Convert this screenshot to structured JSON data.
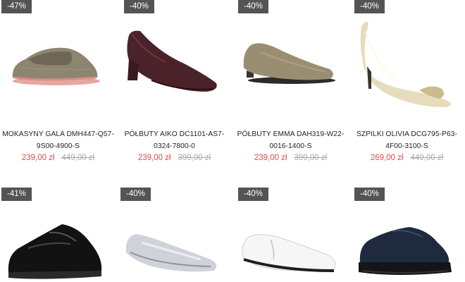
{
  "products": [
    {
      "discount": "-47%",
      "name_line1": "MOKASYNY GALA DMH447-Q57-",
      "name_line2": "9S00-4900-S",
      "price_new": "239,00 zł",
      "price_old": "449,00 zł"
    },
    {
      "discount": "-40%",
      "name_line1": "PÓŁBUTY AIKO DC1101-AS7-",
      "name_line2": "0324-7800-0",
      "price_new": "239,00 zł",
      "price_old": "399,00 zł"
    },
    {
      "discount": "-40%",
      "name_line1": "PÓŁBUTY EMMA DAH319-W22-",
      "name_line2": "0016-1400-S",
      "price_new": "239,00 zł",
      "price_old": "399,00 zł"
    },
    {
      "discount": "-40%",
      "name_line1": "SZPILKI OLIVIA DCG795-P63-",
      "name_line2": "4F00-3100-S",
      "price_new": "269,00 zł",
      "price_old": "449,00 zł"
    },
    {
      "discount": "-41%"
    },
    {
      "discount": "-40%"
    },
    {
      "discount": "-40%"
    },
    {
      "discount": "-40%"
    }
  ]
}
